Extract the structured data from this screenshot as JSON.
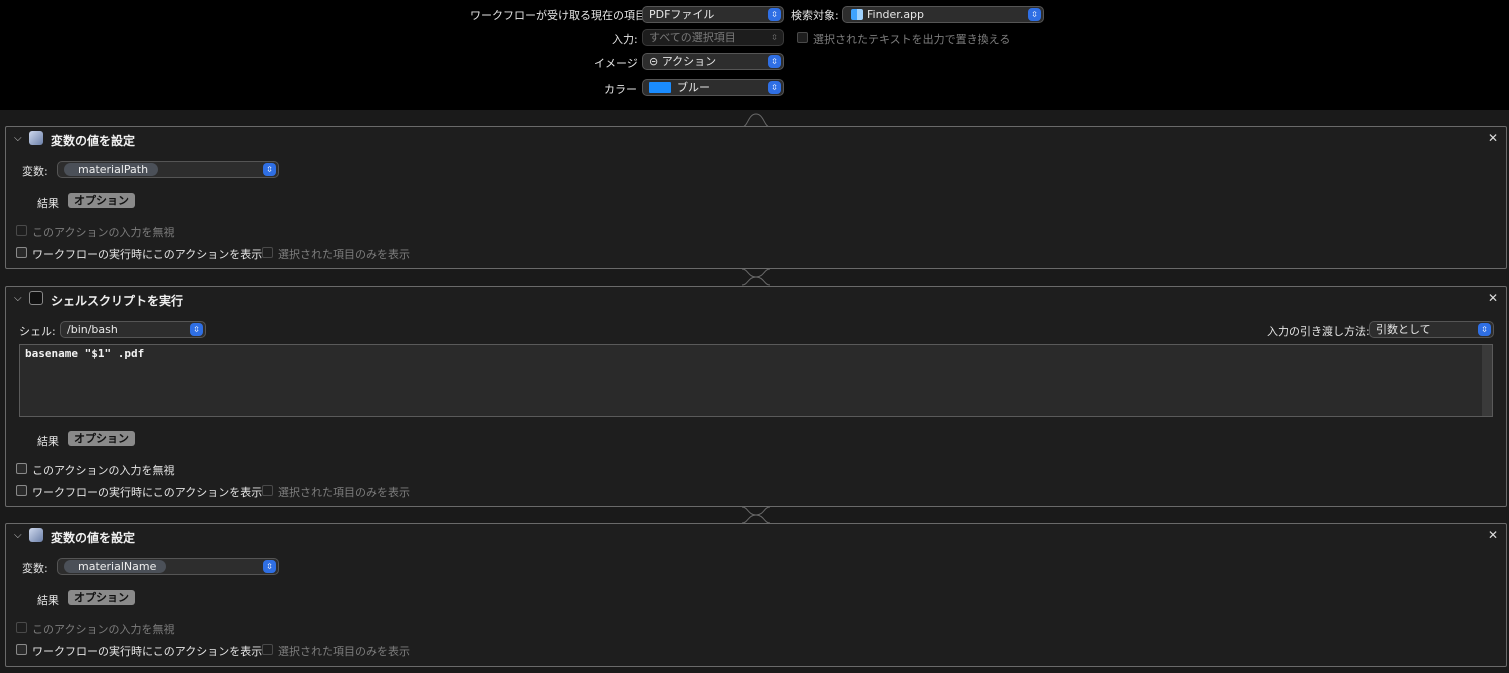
{
  "header": {
    "receives_label": "ワークフローが受け取る現在の項目:",
    "receives_value": "PDFファイル",
    "search_label": "検索対象:",
    "search_value": "Finder.app",
    "input_label": "入力:",
    "input_value": "すべての選択項目",
    "replace_text_label": "選択されたテキストを出力で置き換える",
    "image_label": "イメージ",
    "image_value": "⊝ アクション",
    "color_label": "カラー",
    "color_value": "ブルー",
    "color_swatch": "#1a8cff"
  },
  "actions": [
    {
      "title": "変数の値を設定",
      "variable_label": "変数:",
      "variable_value": "materialPath",
      "result_label": "結果",
      "options_label": "オプション",
      "ignore_input_label": "このアクションの入力を無視",
      "show_label": "ワークフローの実行時にこのアクションを表示",
      "selected_only_label": "選択された項目のみを表示"
    },
    {
      "title": "シェルスクリプトを実行",
      "shell_label": "シェル:",
      "shell_value": "/bin/bash",
      "pass_input_label": "入力の引き渡し方法:",
      "pass_input_value": "引数として",
      "script": "basename \"$1\" .pdf",
      "result_label": "結果",
      "options_label": "オプション",
      "ignore_input_label": "このアクションの入力を無視",
      "show_label": "ワークフローの実行時にこのアクションを表示",
      "selected_only_label": "選択された項目のみを表示"
    },
    {
      "title": "変数の値を設定",
      "variable_label": "変数:",
      "variable_value": "materialName",
      "result_label": "結果",
      "options_label": "オプション",
      "ignore_input_label": "このアクションの入力を無視",
      "show_label": "ワークフローの実行時にこのアクションを表示",
      "selected_only_label": "選択された項目のみを表示"
    }
  ],
  "icons": {
    "chevron": "chevron-down-icon",
    "close": "close-icon",
    "variable": "variable-action-icon",
    "terminal": "terminal-icon",
    "finder": "finder-icon"
  }
}
